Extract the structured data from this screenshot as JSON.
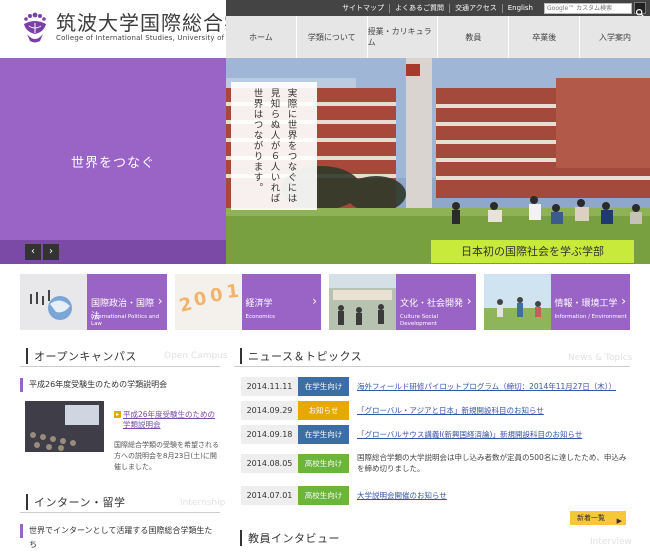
{
  "header": {
    "logo_title": "筑波大学国際総合学類",
    "logo_subtitle": "College of International Studies, University of Tsukuba",
    "top_links": [
      "サイトマップ",
      "よくあるご質問",
      "交通アクセス",
      "English"
    ],
    "search_placeholder": "Google™ カスタム検索"
  },
  "nav": {
    "items": [
      "ホーム",
      "学類について",
      "授業・カリキュラム",
      "教員",
      "卒業後",
      "入学案内"
    ]
  },
  "hero": {
    "tagline": "世界をつなぐ",
    "vertical_lines": [
      "実際に世界をつなぐには",
      "見知らぬ人が６人いれば",
      "世界はつながります。"
    ],
    "caption": "日本初の国際社会を学ぶ学部",
    "prev_label": "‹",
    "next_label": "›"
  },
  "categories": [
    {
      "jp": "国際政治・国際法",
      "en": "International Politics and Law"
    },
    {
      "jp": "経済学",
      "en": "Economics"
    },
    {
      "jp": "文化・社会開発",
      "en": "Culture Social Development"
    },
    {
      "jp": "情報・環境工学",
      "en": "Information / Environment"
    }
  ],
  "open_campus": {
    "heading": "オープンキャンパス",
    "heading_en": "Open Campus",
    "item_title": "平成26年度受験生のための学類説明会",
    "link_text": "平成26年度受験生のための学類説明会",
    "description": "国際総合学類の受験を希望される方への説明会を8月23日(土)に開催しました。"
  },
  "intern": {
    "heading": "インターン・留学",
    "heading_en": "Internship",
    "item_title": "世界でインターンとして活躍する国際総合学類生たち"
  },
  "news": {
    "heading": "ニュース＆トピックス",
    "heading_en": "News & Topics",
    "rows": [
      {
        "date": "2014.11.11",
        "badge": "在学生向け",
        "badge_class": "b-cur",
        "title": "海外フィールド研修パイロットプログラム（締切：2014年11月27日（木））",
        "link": true
      },
      {
        "date": "2014.09.29",
        "badge": "お知らせ",
        "badge_class": "b-info",
        "title": "「グローバル・アジアと日本」新規開設科目のお知らせ",
        "link": true
      },
      {
        "date": "2014.09.18",
        "badge": "在学生向け",
        "badge_class": "b-cur",
        "title": "「グローバルサウス講義Ⅰ(新興国経済論)」新規開設科目のお知らせ",
        "link": true
      },
      {
        "date": "2014.08.05",
        "badge": "高校生向け",
        "badge_class": "b-hs",
        "title": "国際総合学類の大学説明会は申し込み者数が定員の500名に達したため、申込みを締め切りました。",
        "link": false
      },
      {
        "date": "2014.07.01",
        "badge": "高校生向け",
        "badge_class": "b-hs",
        "title": "大学説明会開催のお知らせ",
        "link": true
      }
    ],
    "more_label": "新着一覧"
  },
  "interview": {
    "heading": "教員インタビュー",
    "heading_en": "Interview"
  },
  "colors": {
    "accent_purple": "#9a63c6",
    "caption_green": "#c8ea3a",
    "badge_student": "#3a6ea5",
    "badge_info": "#e6a900",
    "badge_highschool": "#6bb53a"
  }
}
